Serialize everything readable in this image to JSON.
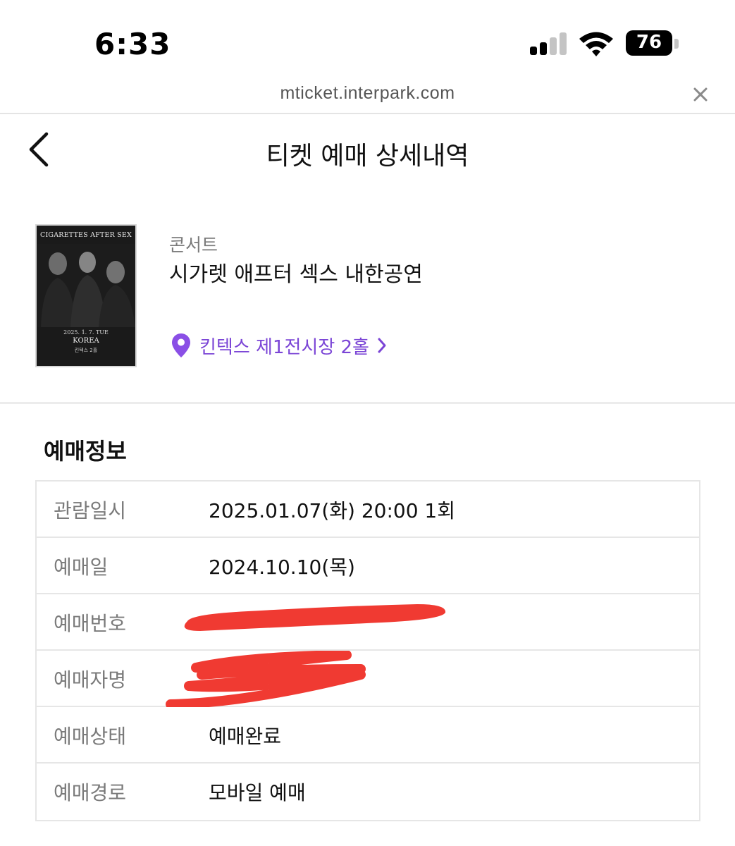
{
  "status_bar": {
    "time": "6:33",
    "battery": "76"
  },
  "browser": {
    "url": "mticket.interpark.com"
  },
  "header": {
    "title": "티켓 예매 상세내역"
  },
  "event": {
    "category": "콘서트",
    "title": "시가렛 애프터 섹스 내한공연",
    "venue": "킨텍스 제1전시장 2홀",
    "poster": {
      "headline": "CIGARETTES AFTER SEX",
      "date": "2025. 1. 7. TUE",
      "country": "KOREA",
      "venue": "킨텍스 2홀"
    }
  },
  "booking_info": {
    "section_title": "예매정보",
    "rows": [
      {
        "label": "관람일시",
        "value": "2025.01.07(화) 20:00 1회"
      },
      {
        "label": "예매일",
        "value": "2024.10.10(목)"
      },
      {
        "label": "예매번호",
        "value": ""
      },
      {
        "label": "예매자명",
        "value": ""
      },
      {
        "label": "예매상태",
        "value": "예매완료"
      },
      {
        "label": "예매경로",
        "value": "모바일 예매"
      }
    ]
  },
  "colors": {
    "accent": "#7b45d6",
    "redaction": "#f03a32"
  }
}
